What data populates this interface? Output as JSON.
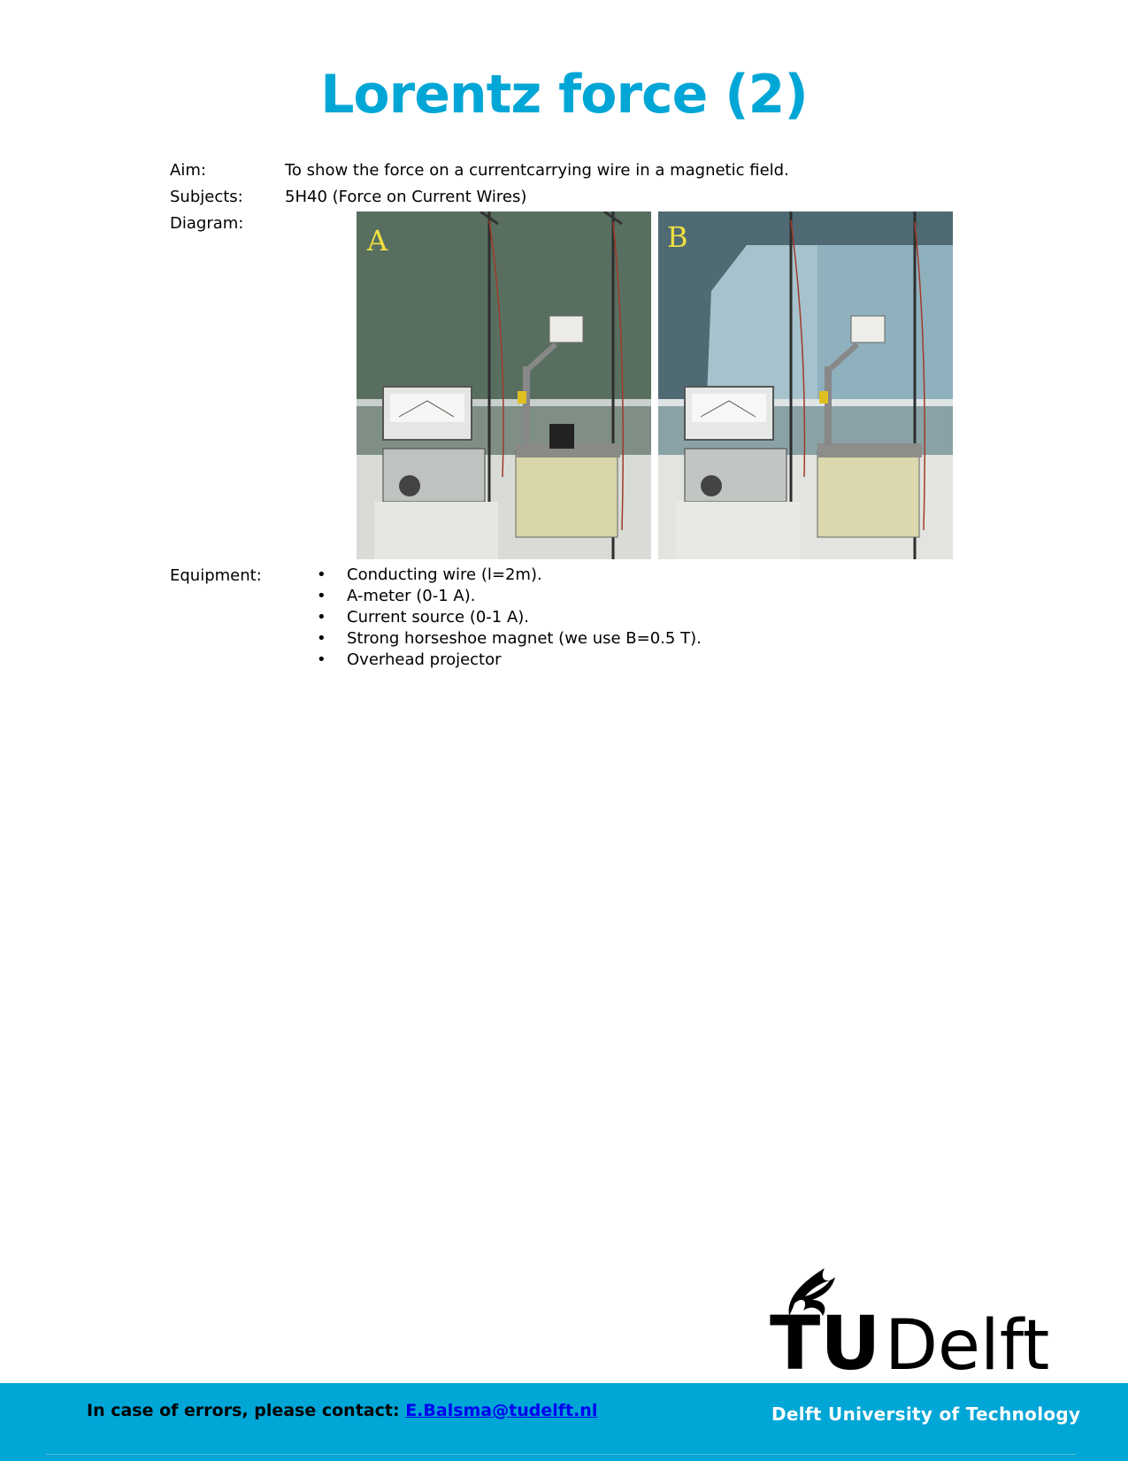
{
  "title": "Lorentz force (2)",
  "aim": {
    "label": "Aim:",
    "value": "To show the force on a currentcarrying wire in a magnetic field."
  },
  "subjects": {
    "label": "Subjects:",
    "value": "5H40 (Force on Current Wires)"
  },
  "diagram": {
    "label": "Diagram:",
    "photos": [
      {
        "letter": "A"
      },
      {
        "letter": "B"
      }
    ]
  },
  "equipment": {
    "label": "Equipment:",
    "bullet": "•",
    "items": [
      "Conducting wire (l=2m).",
      "A-meter (0-1 A).",
      "Current source (0-1 A).",
      "Strong horseshoe magnet (we use B=0.5 T).",
      "Overhead projector"
    ]
  },
  "footer": {
    "contact_prefix": "In case of errors, please contact:",
    "contact_email": "E.Balsma@tudelft.nl",
    "university": "Delft University of Technology"
  },
  "logo": {
    "part1": "TU",
    "part2": "Delft"
  },
  "colors": {
    "accent": "#00a6d6",
    "link": "#0000ee",
    "photo_letter": "#f0e040"
  }
}
